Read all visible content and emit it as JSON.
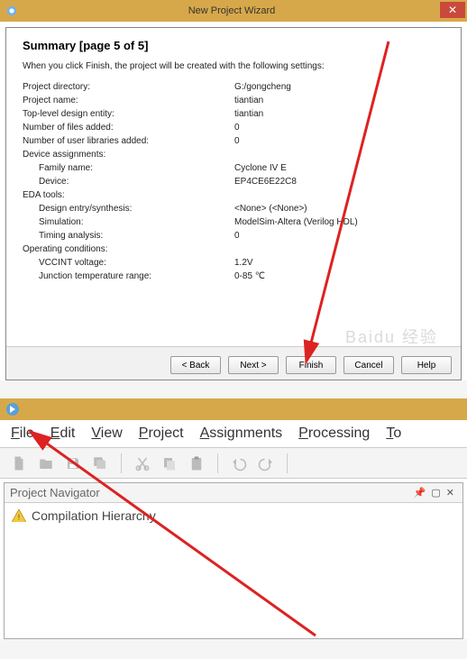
{
  "dialog": {
    "window_title": "New Project Wizard",
    "page_title": "Summary [page 5 of 5]",
    "intro": "When you click Finish, the project will be created with the following settings:",
    "rows": [
      {
        "label": "Project directory:",
        "value": "G:/gongcheng",
        "indent": 0
      },
      {
        "label": "Project name:",
        "value": "tiantian",
        "indent": 0
      },
      {
        "label": "Top-level design entity:",
        "value": "tiantian",
        "indent": 0
      },
      {
        "label": "Number of files added:",
        "value": "0",
        "indent": 0
      },
      {
        "label": "Number of user libraries added:",
        "value": "0",
        "indent": 0
      },
      {
        "label": "Device assignments:",
        "value": "",
        "indent": 0
      },
      {
        "label": "Family name:",
        "value": "Cyclone IV E",
        "indent": 1
      },
      {
        "label": "Device:",
        "value": "EP4CE6E22C8",
        "indent": 1
      },
      {
        "label": "EDA tools:",
        "value": "",
        "indent": 0
      },
      {
        "label": "Design entry/synthesis:",
        "value": "<None> (<None>)",
        "indent": 1
      },
      {
        "label": "Simulation:",
        "value": "ModelSim-Altera (Verilog HDL)",
        "indent": 1
      },
      {
        "label": "Timing analysis:",
        "value": "0",
        "indent": 1
      },
      {
        "label": "Operating conditions:",
        "value": "",
        "indent": 0
      },
      {
        "label": "VCCINT voltage:",
        "value": "1.2V",
        "indent": 1
      },
      {
        "label": "Junction temperature range:",
        "value": "0-85 ℃",
        "indent": 1
      }
    ],
    "buttons": {
      "back": "< Back",
      "next": "Next >",
      "finish": "Finish",
      "cancel": "Cancel",
      "help": "Help"
    },
    "watermark": "Baidu 经验"
  },
  "ide": {
    "menus": [
      "File",
      "Edit",
      "View",
      "Project",
      "Assignments",
      "Processing",
      "To"
    ],
    "panel_title": "Project Navigator",
    "tree_item": "Compilation Hierarchy"
  }
}
